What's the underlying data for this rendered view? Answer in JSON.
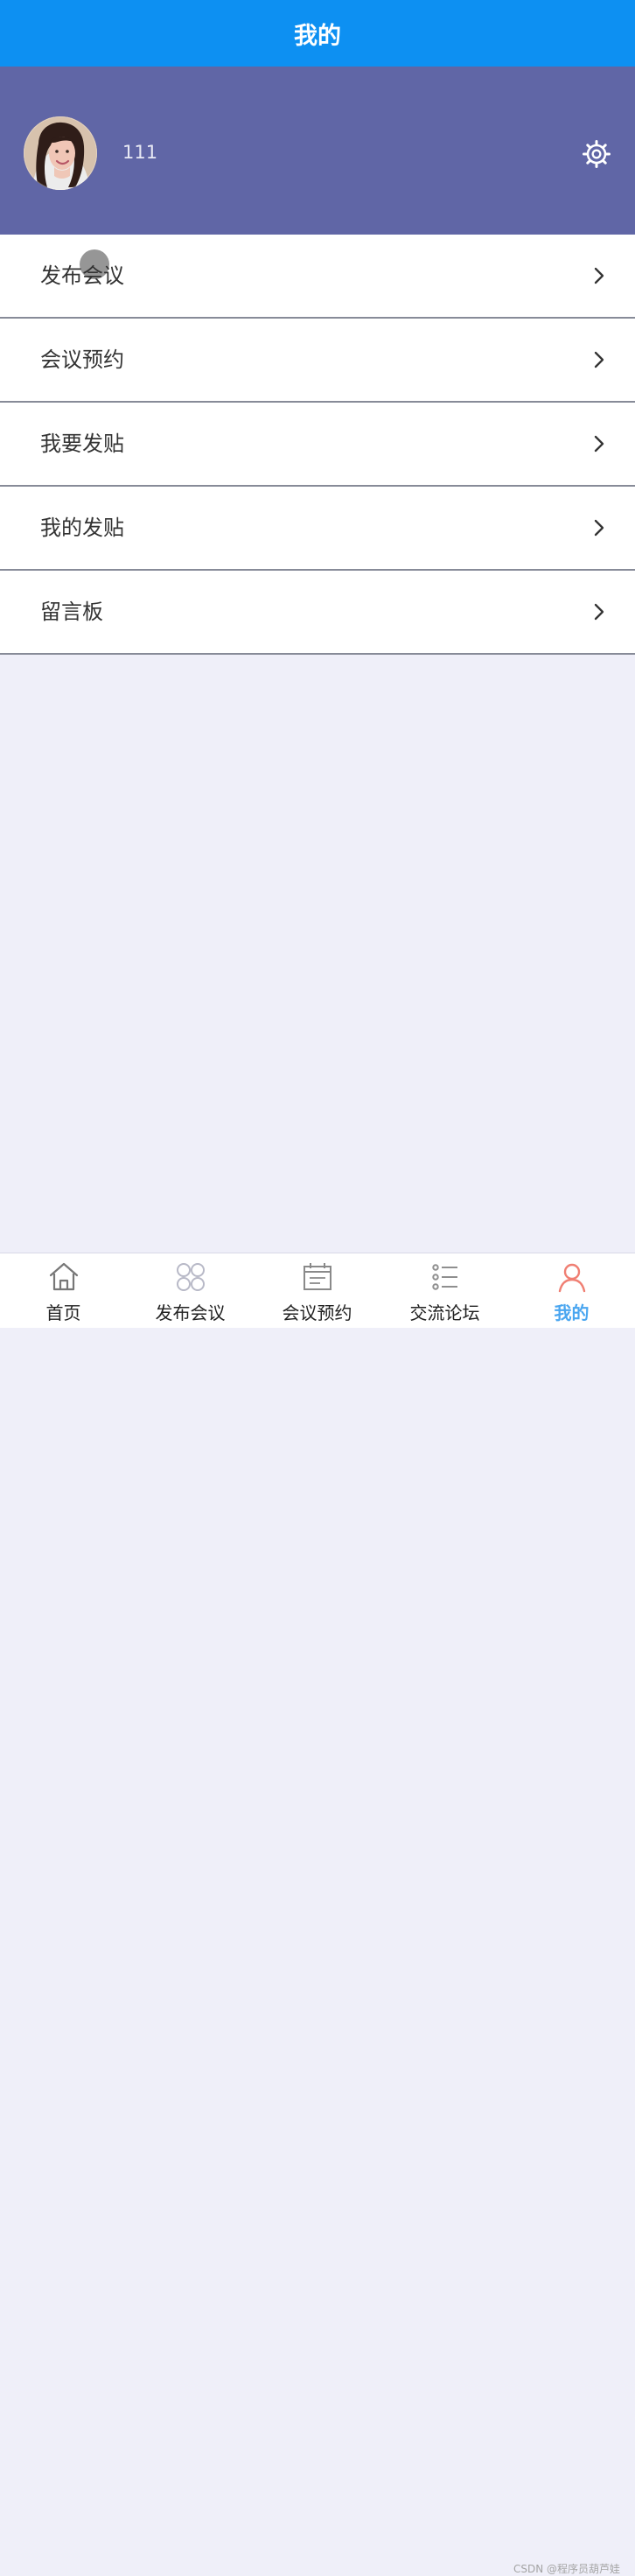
{
  "header": {
    "title": "我的"
  },
  "profile": {
    "username": "111",
    "avatar_icon": "user-avatar-photo",
    "settings_icon": "gear-icon"
  },
  "menu": {
    "items": [
      {
        "label": "发布会议",
        "icon": "chevron-right-icon"
      },
      {
        "label": "会议预约",
        "icon": "chevron-right-icon"
      },
      {
        "label": "我要发贴",
        "icon": "chevron-right-icon"
      },
      {
        "label": "我的发贴",
        "icon": "chevron-right-icon"
      },
      {
        "label": "留言板",
        "icon": "chevron-right-icon"
      }
    ]
  },
  "tabbar": {
    "items": [
      {
        "label": "首页",
        "icon": "home-icon",
        "active": false
      },
      {
        "label": "发布会议",
        "icon": "four-circles-icon",
        "active": false
      },
      {
        "label": "会议预约",
        "icon": "calendar-icon",
        "active": false
      },
      {
        "label": "交流论坛",
        "icon": "list-icon",
        "active": false
      },
      {
        "label": "我的",
        "icon": "user-icon",
        "active": true
      }
    ]
  },
  "watermark": {
    "text": "CSDN @程序员葫芦娃"
  },
  "colors": {
    "header_bg": "#0d90f2",
    "profile_bg": "#6066a6",
    "page_bg": "#efeff9",
    "active_tab_icon": "#f07f73",
    "active_tab_label": "#4aa6f0"
  }
}
